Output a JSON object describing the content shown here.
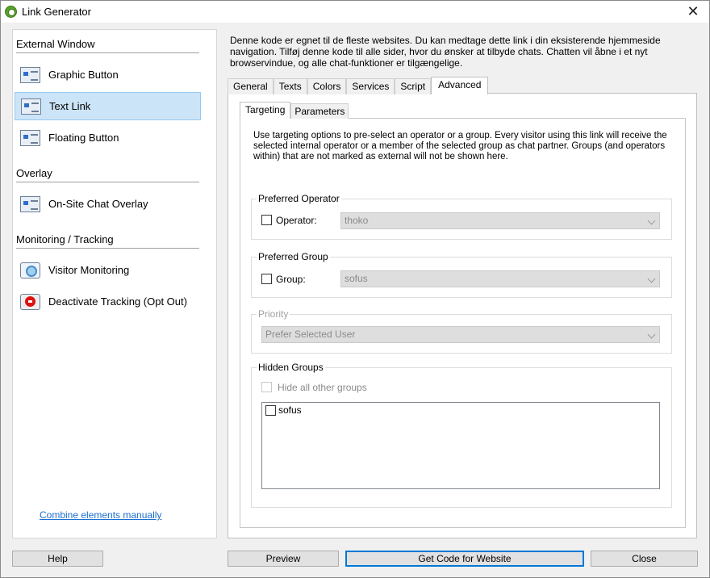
{
  "window": {
    "title": "Link Generator"
  },
  "sidebar": {
    "sections": [
      {
        "title": "External Window"
      },
      {
        "title": "Overlay"
      },
      {
        "title": "Monitoring / Tracking"
      }
    ],
    "items": [
      {
        "label": "Graphic Button",
        "icon": "graphic-button-icon"
      },
      {
        "label": "Text Link",
        "icon": "text-link-icon",
        "selected": true
      },
      {
        "label": "Floating Button",
        "icon": "floating-button-icon"
      },
      {
        "label": "On-Site Chat Overlay",
        "icon": "chat-overlay-icon"
      },
      {
        "label": "Visitor Monitoring",
        "icon": "visitor-monitoring-icon"
      },
      {
        "label": "Deactivate Tracking (Opt Out)",
        "icon": "opt-out-icon"
      }
    ],
    "combine_link": "Combine elements manually"
  },
  "main": {
    "description": "Denne kode er egnet til de fleste websites. Du kan medtage dette link i din eksisterende hjemmeside navigation. Tilføj denne kode til alle sider, hvor du ønsker at tilbyde chats. Chatten vil åbne i et nyt browservindue, og alle chat-funktioner er tilgængelige.",
    "tabs": [
      "General",
      "Texts",
      "Colors",
      "Services",
      "Script",
      "Advanced"
    ],
    "active_tab": "Advanced",
    "subtabs": [
      "Targeting",
      "Parameters"
    ],
    "active_subtab": "Targeting",
    "targeting": {
      "intro": "Use targeting options to pre-select an operator or a group. Every visitor using this link will receive the selected internal operator or a member of the selected group as chat partner. Groups (and operators within) that are not marked as external will not be shown here.",
      "preferred_operator": {
        "title": "Preferred Operator",
        "checkbox_label": "Operator:",
        "value": "thoko"
      },
      "preferred_group": {
        "title": "Preferred Group",
        "checkbox_label": "Group:",
        "value": "sofus"
      },
      "priority": {
        "title": "Priority",
        "value": "Prefer Selected User"
      },
      "hidden_groups": {
        "title": "Hidden Groups",
        "hide_all_label": "Hide all other groups",
        "items": [
          {
            "label": "sofus",
            "checked": false
          }
        ]
      }
    }
  },
  "footer": {
    "help": "Help",
    "preview": "Preview",
    "get_code": "Get Code for Website",
    "close": "Close"
  }
}
